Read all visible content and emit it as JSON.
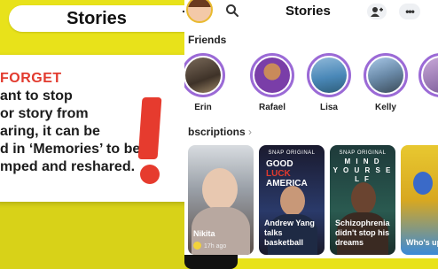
{
  "callout": {
    "label": "Stories"
  },
  "note": {
    "title": "FORGET",
    "lines": [
      "ant to stop",
      "or story from",
      "aring, it can be",
      "d in ‘Memories’ to be",
      "mped and reshared."
    ]
  },
  "app": {
    "title": "Stories",
    "sections": {
      "friends": "Friends",
      "subscriptions": "bscriptions"
    }
  },
  "friends": [
    {
      "name": "Erin"
    },
    {
      "name": "Rafael"
    },
    {
      "name": "Lisa"
    },
    {
      "name": "Kelly"
    }
  ],
  "tiles": [
    {
      "caption": "Nikita",
      "meta": "17h ago"
    },
    {
      "top": "SNAP ORIGINAL",
      "title_line1": "GOOD",
      "title_line2": "LUCK",
      "title_line3": "AMERICA",
      "caption": "Andrew Yang talks basketball"
    },
    {
      "top": "SNAP ORIGINAL",
      "title": "M I N D\nY O U R S E L F",
      "caption": "Schizophrenia didn't stop his dreams"
    },
    {
      "caption": "Who's up to s"
    }
  ],
  "colors": {
    "background": "#e8e21a",
    "accent_red": "#e23a2e",
    "ring": "#9b6ad6"
  }
}
